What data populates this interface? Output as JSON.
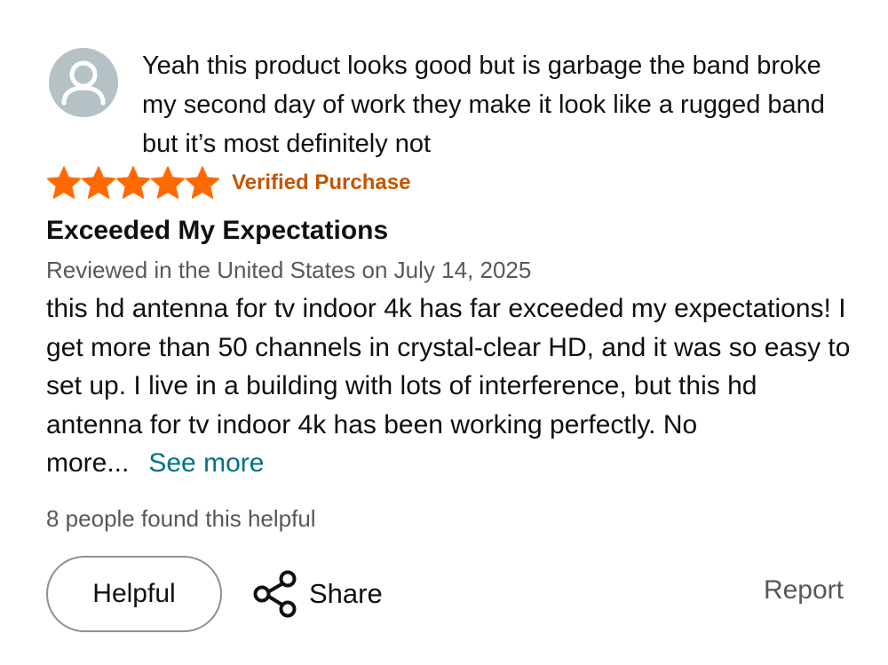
{
  "previous_comment": {
    "text": "Yeah this product looks good but is garbage the band broke my second day of work they make it look like a rugged band but it’s most definitely not"
  },
  "review": {
    "rating": 5,
    "rating_max": 5,
    "star_color": "#ff6a00",
    "verified_label": "Verified Purchase",
    "verified_color": "#c45500",
    "title": "Exceeded My Expectations",
    "meta": "Reviewed in the United States on July 14, 2025",
    "body": "this hd antenna for tv indoor 4k has far exceeded my expectations! I get more than 50 channels in crystal-clear HD, and it was so easy to set up. I live in a building with lots of interference, but this hd antenna for tv indoor 4k has been working perfectly. No more...",
    "see_more_label": "See more",
    "link_color": "#007185",
    "helpful_count_text": "8 people found this helpful"
  },
  "actions": {
    "helpful_label": "Helpful",
    "share_label": "Share",
    "share_icon": "share-icon",
    "report_label": "Report"
  },
  "avatar": {
    "icon": "user-icon",
    "bg_color": "#b4c1c5"
  }
}
